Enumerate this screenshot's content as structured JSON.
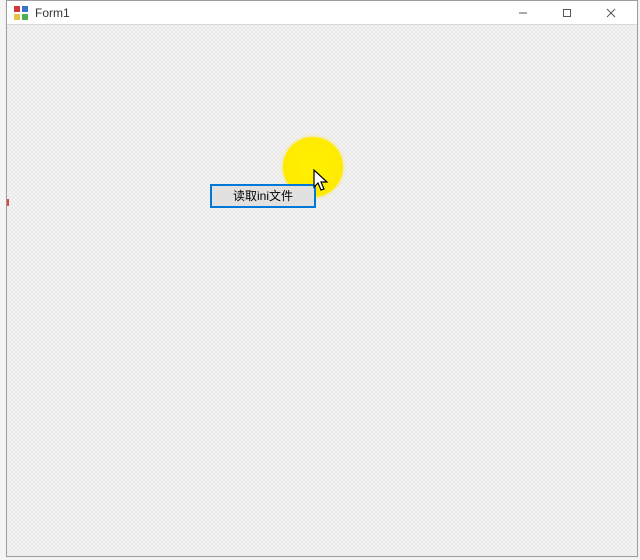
{
  "window": {
    "title": "Form1"
  },
  "buttons": {
    "read_ini_label": "读取ini文件"
  },
  "colors": {
    "focus_border": "#0078d7",
    "highlight": "#fff200"
  }
}
